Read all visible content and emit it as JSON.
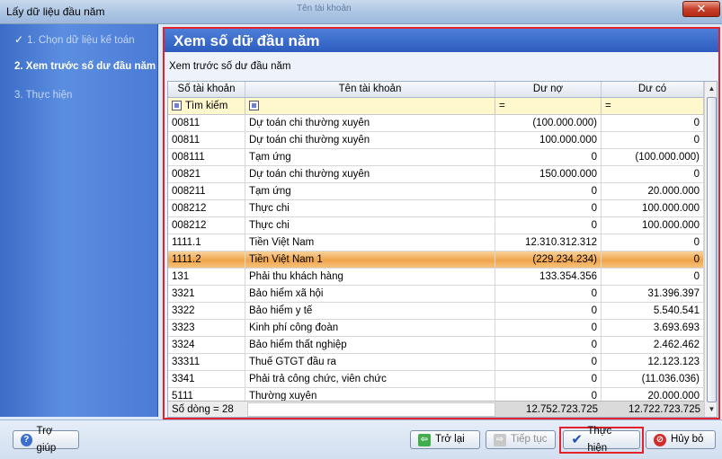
{
  "window": {
    "title": "Lấy dữ liệu đầu năm",
    "faded_text": "Tên tài khoản",
    "close_label": "✕"
  },
  "nav": {
    "steps": [
      {
        "label": "1. Chọn dữ liệu kế toán",
        "mark": "✓"
      },
      {
        "label": "2. Xem trước số dư đầu năm"
      },
      {
        "label": "3. Thực hiện"
      }
    ]
  },
  "panel": {
    "title": "Xem số dữ đầu năm",
    "subtitle": "Xem trước số dư đầu năm"
  },
  "grid": {
    "headers": [
      "Số tài khoản",
      "Tên tài khoản",
      "Dư nợ",
      "Dư có"
    ],
    "filter": {
      "first_label": "Tìm kiếm",
      "eq1": "=",
      "eq2": "="
    },
    "rows": [
      [
        "00811",
        "Dự toán chi thường xuyên",
        "(100.000.000)",
        "0"
      ],
      [
        "00811",
        "Dự toán chi thường xuyên",
        "100.000.000",
        "0"
      ],
      [
        "008111",
        "Tạm ứng",
        "0",
        "(100.000.000)"
      ],
      [
        "00821",
        "Dự toán chi thường xuyên",
        "150.000.000",
        "0"
      ],
      [
        "008211",
        "Tạm ứng",
        "0",
        "20.000.000"
      ],
      [
        "008212",
        "Thực chi",
        "0",
        "100.000.000"
      ],
      [
        "008212",
        "Thực chi",
        "0",
        "100.000.000"
      ],
      [
        "1111.1",
        "Tiền Việt Nam",
        "12.310.312.312",
        "0"
      ],
      [
        "1111.2",
        "Tiền Việt Nam 1",
        "(229.234.234)",
        "0"
      ],
      [
        "131",
        "Phải thu khách hàng",
        "133.354.356",
        "0"
      ],
      [
        "3321",
        "Bảo hiểm xã hội",
        "0",
        "31.396.397"
      ],
      [
        "3322",
        "Bảo hiểm y tế",
        "0",
        "5.540.541"
      ],
      [
        "3323",
        "Kinh phí công đoàn",
        "0",
        "3.693.693"
      ],
      [
        "3324",
        "Bảo hiểm thất nghiệp",
        "0",
        "2.462.462"
      ],
      [
        "33311",
        "Thuế GTGT đầu ra",
        "0",
        "12.123.123"
      ],
      [
        "3341",
        "Phải trả công chức, viên chức",
        "0",
        "(11.036.036)"
      ],
      [
        "5111",
        "Thường xuyên",
        "0",
        "20.000.000"
      ]
    ],
    "selected_row": 8,
    "footer": {
      "count": "Số dòng = 28",
      "sum_debit": "12.752.723.725",
      "sum_credit": "12.722.723.725"
    }
  },
  "buttons": {
    "help": "Trợ giúp",
    "back": "Trở lại",
    "next": "Tiếp tục",
    "execute": "Thực hiện",
    "cancel": "Hủy bỏ"
  },
  "colors": {
    "highlight_border": "#e2222c",
    "panel_header": "#2c5cbf",
    "selected_row": "#f0a54a"
  }
}
